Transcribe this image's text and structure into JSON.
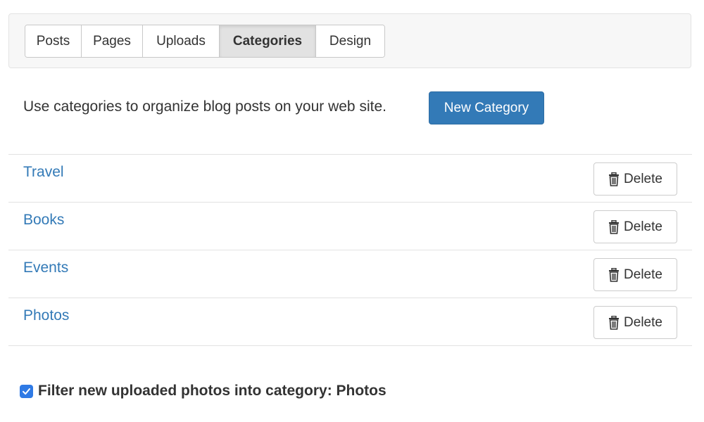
{
  "tabs": [
    {
      "label": "Posts",
      "active": false
    },
    {
      "label": "Pages",
      "active": false
    },
    {
      "label": "Uploads",
      "active": false
    },
    {
      "label": "Categories",
      "active": true
    },
    {
      "label": "Design",
      "active": false
    }
  ],
  "intro": {
    "text": "Use categories to organize blog posts on your web site.",
    "new_button_label": "New Category"
  },
  "categories": [
    {
      "name": "Travel",
      "delete_label": "Delete"
    },
    {
      "name": "Books",
      "delete_label": "Delete"
    },
    {
      "name": "Events",
      "delete_label": "Delete"
    },
    {
      "name": "Photos",
      "delete_label": "Delete"
    }
  ],
  "filter": {
    "checked": true,
    "label": "Filter new uploaded photos into category: Photos"
  },
  "colors": {
    "link": "#337ab7",
    "primary_button": "#337ab7",
    "checkbox": "#2f7ae5",
    "active_tab_bg": "#e2e2e2"
  },
  "icons": {
    "delete": "trash-icon",
    "checkbox": "checkmark-icon"
  }
}
